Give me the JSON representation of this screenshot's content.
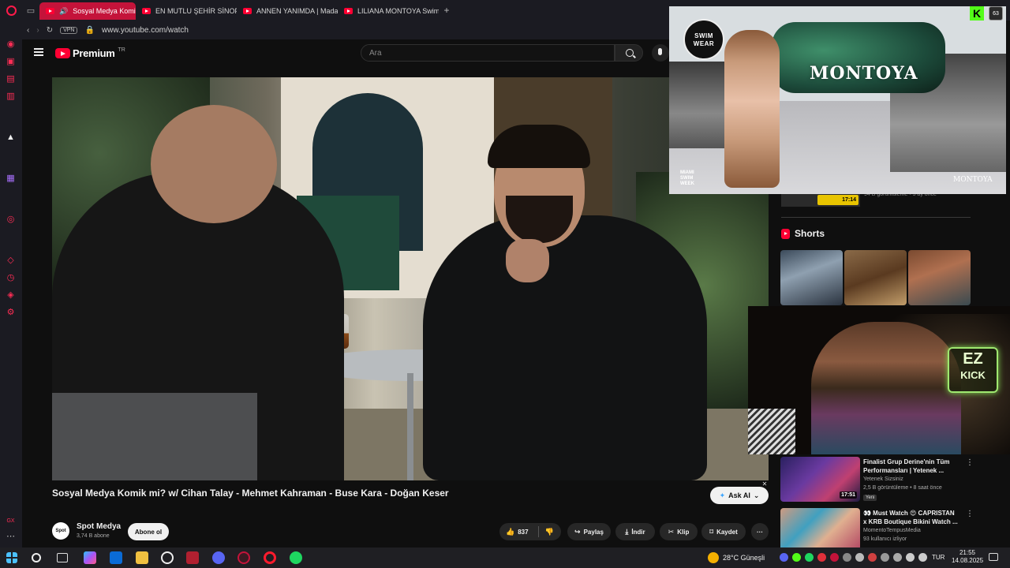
{
  "browser": {
    "tabs": [
      {
        "label": "Sosyal Medya Komik",
        "active": true
      },
      {
        "label": "EN MUTLU ŞEHİR SİNOP",
        "active": false
      },
      {
        "label": "ANNEN YANIMDA | Mada",
        "active": false
      },
      {
        "label": "LILIANA MONTOYA Swim",
        "active": false
      }
    ],
    "new_tab": "+",
    "vpn_label": "VPN",
    "url": "www.youtube.com/watch"
  },
  "youtube": {
    "logo_text": "Premium",
    "logo_region": "TR",
    "search_placeholder": "Ara"
  },
  "video": {
    "title": "Sosyal Medya Komik mi? w/ Cihan Talay - Mehmet Kahraman - Buse Kara - Doğan Keser",
    "ask_ai_label": "Ask AI",
    "channel_avatar_text": "Spot",
    "channel_name": "Spot Medya",
    "subscribers": "3,74 B abone",
    "subscribe_label": "Abone ol",
    "likes": "837",
    "share_label": "Paylaş",
    "download_label": "İndir",
    "clip_label": "Klip",
    "save_label": "Kaydet",
    "more_label": "···"
  },
  "sidebar_recs": {
    "top_item": {
      "duration": "17:14",
      "meta": "94 B görüntüleme • 5 ay önce"
    },
    "shorts_heading": "Shorts",
    "items": [
      {
        "title": "Finalist Grup Derine'nin Tüm Performansları | Yetenek ...",
        "channel": "Yetenek Sizsiniz",
        "meta": "2,5 B görüntüleme • 8 saat önce",
        "badge": "Yeni",
        "duration": "17:51"
      },
      {
        "title": "👀 Must Watch 😍 CAPRISTAN x KRB Boutique Bikini Watch ...",
        "channel": "MomentoTempusMedia",
        "meta": "93 kullanıcı izliyor",
        "badge": "",
        "duration": ""
      }
    ]
  },
  "overlay": {
    "swimwear_logo": "SWIM WEAR",
    "brand": "MONTOYA",
    "miami_logo": "MIAMI SWIM WEEK",
    "brand_small": "MONTOYA",
    "kick_logo": "K",
    "kick_badge": "63",
    "neon_top": "EZ",
    "neon_bottom": "KICK"
  },
  "taskbar": {
    "weather": "28°C Güneşli",
    "language": "TUR",
    "time": "21:55",
    "date": "14.08.2025"
  }
}
